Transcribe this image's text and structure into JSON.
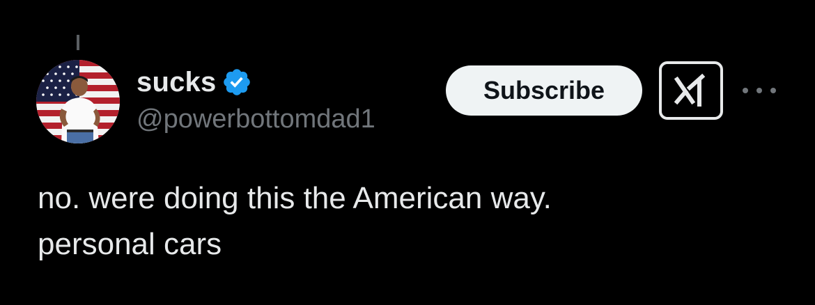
{
  "tweet": {
    "author": {
      "display_name": "sucks",
      "handle": "@powerbottomdad1",
      "verified": true,
      "verified_icon": "verified-badge-icon",
      "avatar": "man-in-front-of-american-flag"
    },
    "actions": {
      "subscribe_label": "Subscribe",
      "grok_icon": "grok-icon",
      "more_icon": "more-horizontal-icon"
    },
    "text_lines": [
      "no. were doing this the American way.",
      "personal cars"
    ]
  },
  "colors": {
    "background": "#000000",
    "text_primary": "#e7e9ea",
    "text_secondary": "#71767b",
    "verified_blue": "#1d9bf0",
    "button_bg": "#eff3f4"
  }
}
